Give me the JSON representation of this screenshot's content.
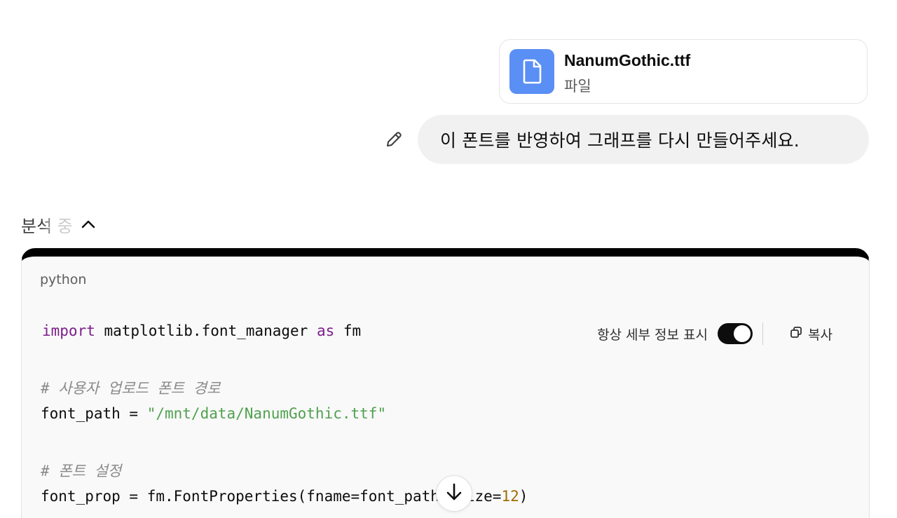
{
  "attachment": {
    "file_name": "NanumGothic.ttf",
    "file_type": "파일",
    "icon": "document-icon"
  },
  "user_message": {
    "text": "이 폰트를 반영하여 그래프를 다시 만들어주세요.",
    "edit_icon": "pencil-icon"
  },
  "analysis": {
    "label": "분석 중",
    "chevron_icon": "chevron-up-icon"
  },
  "code_block": {
    "language": "python",
    "toggle_label": "항상 세부 정보 표시",
    "toggle_on": true,
    "copy_label": "복사",
    "lines": {
      "l1_kw1": "import",
      "l1_mid": " matplotlib.font_manager ",
      "l1_kw2": "as",
      "l1_end": " fm",
      "l2_comment": "# 사용자 업로드 폰트 경로",
      "l3_pre": "font_path = ",
      "l3_str": "\"/mnt/data/NanumGothic.ttf\"",
      "l4_comment": "# 폰트 설정",
      "l5_pre": "font_prop = fm.FontProperties(fname=font_path, size=",
      "l5_num": "12",
      "l5_end": ")"
    }
  },
  "scroll_button": {
    "icon": "arrow-down-icon"
  }
}
